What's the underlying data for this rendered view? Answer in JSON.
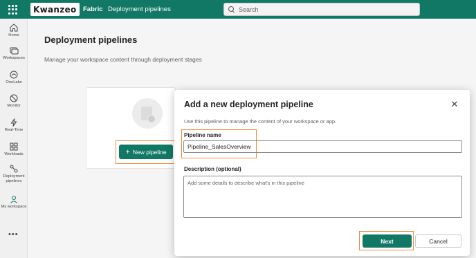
{
  "topbar": {
    "logo_text": "Kwanzeo",
    "brand": "Fabric",
    "breadcrumb": "Deployment pipelines",
    "search_placeholder": "Search"
  },
  "rail": {
    "items": [
      {
        "label": "Home",
        "icon": "home-icon"
      },
      {
        "label": "Workspaces",
        "icon": "workspaces-icon"
      },
      {
        "label": "OneLake",
        "icon": "onelake-icon"
      },
      {
        "label": "Monitor",
        "icon": "monitor-icon"
      },
      {
        "label": "Real-Time",
        "icon": "realtime-icon"
      },
      {
        "label": "Workloads",
        "icon": "workloads-icon"
      },
      {
        "label": "Deployment pipelines",
        "icon": "deployment-pipelines-icon"
      },
      {
        "label": "My workspace",
        "icon": "my-workspace-icon"
      }
    ],
    "more": "•••"
  },
  "main": {
    "title": "Deployment pipelines",
    "subtitle": "Manage your workspace content through deployment stages",
    "new_pipeline_label": "New pipeline"
  },
  "dialog": {
    "title": "Add a new deployment pipeline",
    "description": "Use this pipeline to manage the content of your workspace or app.",
    "name_label": "Pipeline name",
    "name_value": "Pipeline_SalesOverview",
    "desc_label": "Description (optional)",
    "desc_placeholder": "Add some details to describe what's in this pipeline",
    "next_label": "Next",
    "cancel_label": "Cancel"
  },
  "colors": {
    "brand": "#117865",
    "highlight": "#f08a3c"
  }
}
